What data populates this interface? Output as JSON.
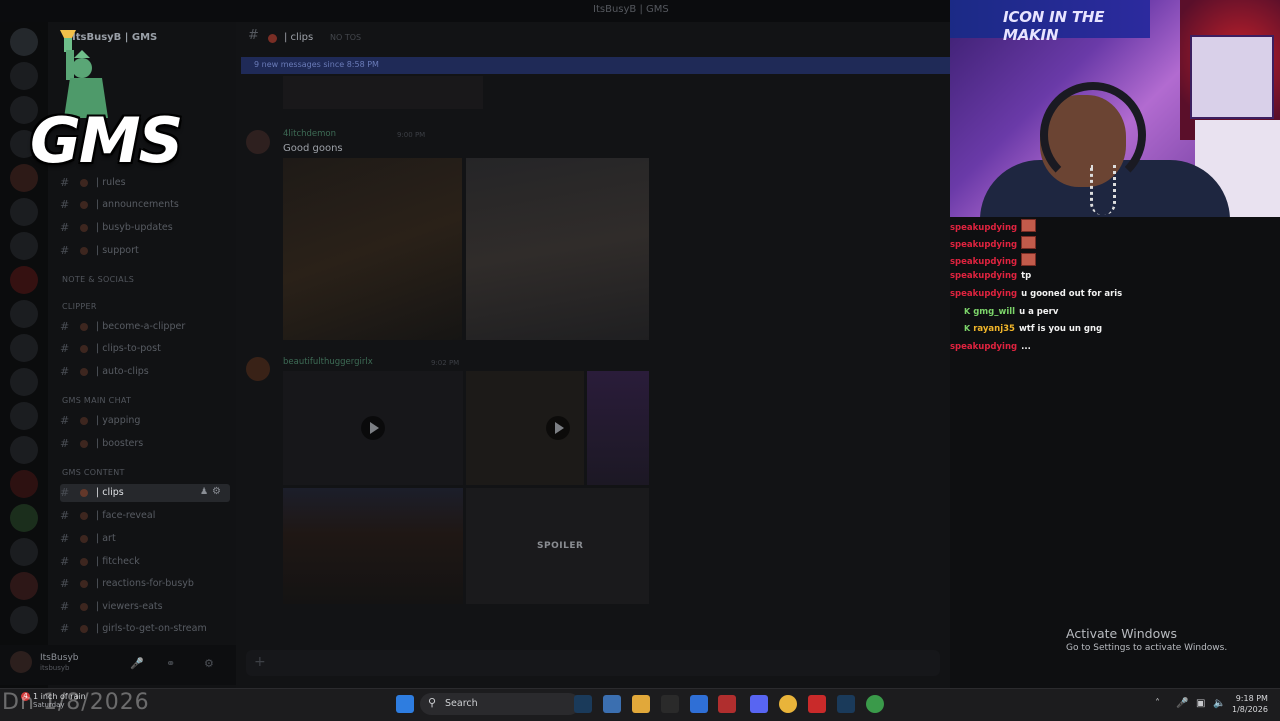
{
  "window": {
    "title": "ItsBusyB | GMS"
  },
  "server": {
    "name": "ItsBusyB | GMS"
  },
  "channels": {
    "categories": [
      "NOTE & SOCIALS",
      "CLIPPER",
      "GMS MAIN CHAT",
      "GMS CONTENT"
    ],
    "items": [
      "| rules",
      "| announcements",
      "| busyb-updates",
      "| support",
      "| become-a-clipper",
      "| clips-to-post",
      "| auto-clips",
      "| yapping",
      "| boosters",
      "| clips",
      "| face-reveal",
      "| art",
      "| fitcheck",
      "| reactions-for-busyb",
      "| viewers-eats",
      "| girls-to-get-on-stream"
    ],
    "active": "| clips"
  },
  "user": {
    "name": "ItsBusyb",
    "status": "itsbusyb"
  },
  "chat_channel": {
    "name": "| clips",
    "topic": "NO TOS"
  },
  "new_messages": "9 new messages since 8:58 PM",
  "messages": [
    {
      "author": "4litchdemon",
      "time": "9:00 PM",
      "text": "Good goons"
    },
    {
      "author": "beautifulthuggergirlx",
      "time": "9:02 PM",
      "text": ""
    }
  ],
  "spoiler_label": "SPOILER",
  "logo": {
    "text": "GMS"
  },
  "webcam": {
    "banner": "ICON IN THE MAKIN"
  },
  "stream_chat": [
    {
      "user": "speakupdying",
      "msg": "",
      "emote": true,
      "color": "#e0233f"
    },
    {
      "user": "speakupdying",
      "msg": "",
      "emote": true,
      "color": "#e0233f"
    },
    {
      "user": "speakupdying",
      "msg": "",
      "emote": true,
      "color": "#e0233f"
    },
    {
      "user": "speakupdying",
      "msg": "tp",
      "emote": false,
      "color": "#e0233f"
    },
    {
      "user": "speakupdying",
      "msg": "u gooned out for aris",
      "emote": false,
      "color": "#e0233f"
    },
    {
      "user": "gmg_will",
      "msg": "u a perv",
      "emote": false,
      "color": "#7cd46a"
    },
    {
      "user": "rayanj35",
      "msg": "wtf is you un gng",
      "emote": false,
      "color": "#f0b52a"
    },
    {
      "user": "speakupdying",
      "msg": "...",
      "emote": false,
      "color": "#e0233f"
    }
  ],
  "activation": {
    "line1": "Activate Windows",
    "line2": "Go to Settings to activate Windows."
  },
  "taskbar": {
    "search": "Search",
    "weather_line1": "1 inch of rain",
    "weather_line2": "Saturday",
    "notif_count": "4",
    "time": "9:18 PM",
    "date": "1/8/2026"
  },
  "overlay_date": "Dn 1/8/2026"
}
